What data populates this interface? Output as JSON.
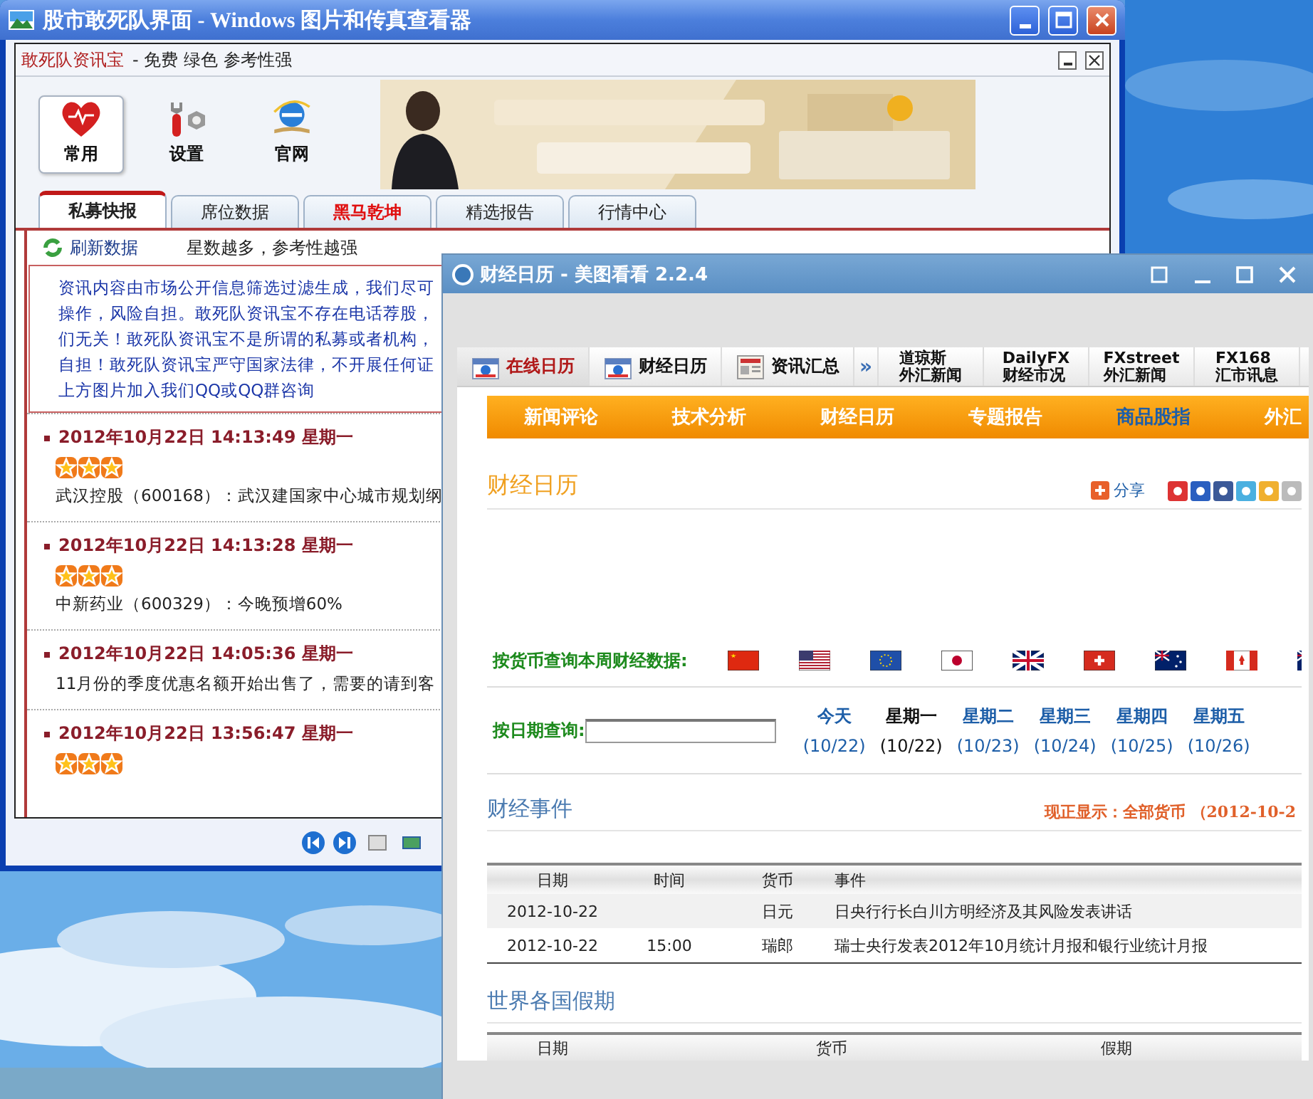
{
  "back_window": {
    "title": "股市敢死队界面 - Windows 图片和传真查看器",
    "app_name": "敢死队资讯宝",
    "app_tagline": "- 免费 绿色 参考性强",
    "tools": [
      {
        "label": "常用",
        "selected": true,
        "kind": "heart"
      },
      {
        "label": "设置",
        "selected": false,
        "kind": "wrench"
      },
      {
        "label": "官网",
        "selected": false,
        "kind": "browser"
      }
    ],
    "tabs": [
      {
        "label": "私募快报",
        "selected": true,
        "emphasized": false
      },
      {
        "label": "席位数据",
        "selected": false,
        "emphasized": false
      },
      {
        "label": "黑马乾坤",
        "selected": false,
        "emphasized": true
      },
      {
        "label": "精选报告",
        "selected": false,
        "emphasized": false
      },
      {
        "label": "行情中心",
        "selected": false,
        "emphasized": false
      }
    ],
    "refresh": "刷新数据",
    "hint": "星数越多，参考性越强",
    "notice": [
      "资讯内容由市场公开信息筛选过滤生成，我们尽可",
      "操作，风险自担。敢死队资讯宝不存在电话荐股，",
      "们无关！敢死队资讯宝不是所谓的私募或者机构，",
      "自担！敢死队资讯宝严守国家法律，不开展任何证",
      "上方图片加入我们QQ或QQ群咨询"
    ],
    "news": [
      {
        "date": "2012年10月22日",
        "time": "14:13:49",
        "weekday": "星期一",
        "stars": 3,
        "text": "武汉控股（600168）：武汉建国家中心城市规划纲"
      },
      {
        "date": "2012年10月22日",
        "time": "14:13:28",
        "weekday": "星期一",
        "stars": 3,
        "text": "中新药业（600329）：今晚预增60%"
      },
      {
        "date": "2012年10月22日",
        "time": "14:05:36",
        "weekday": "星期一",
        "text": "11月份的季度优惠名额开始出售了，需要的请到客"
      },
      {
        "date": "2012年10月22日",
        "time": "13:56:47",
        "weekday": "星期一",
        "stars": 3
      }
    ]
  },
  "front_window": {
    "title": "财经日历 - 美图看看 2.2.4",
    "nav_tabs": [
      {
        "kind": "icon",
        "label": "在线日历",
        "selected": true
      },
      {
        "kind": "icon",
        "label": "财经日历",
        "selected": false
      },
      {
        "kind": "news",
        "label": "资讯汇总",
        "selected": false
      },
      {
        "kind": "arrow",
        "label": "»",
        "selected": false
      },
      {
        "kind": "two-line",
        "label": "道琼斯",
        "sublabel": "外汇新闻",
        "selected": false
      },
      {
        "kind": "two-line",
        "label": "DailyFX",
        "sublabel": "财经市况",
        "selected": false
      },
      {
        "kind": "two-line",
        "label": "FXstreet",
        "sublabel": "外汇新闻",
        "selected": false
      },
      {
        "kind": "two-line",
        "label": "FX168",
        "sublabel": "汇市讯息",
        "selected": false
      }
    ],
    "menu": [
      {
        "label": "新闻评论",
        "selected": false
      },
      {
        "label": "技术分析",
        "selected": false
      },
      {
        "label": "财经日历",
        "selected": false
      },
      {
        "label": "专题报告",
        "selected": false
      },
      {
        "label": "商品股指",
        "selected": true
      },
      {
        "label": "外汇",
        "selected": false
      }
    ],
    "page_title": "财经日历",
    "share": "分享",
    "currency_label": "按货币查询本周财经数据:",
    "date_label": "按日期查询:",
    "days": [
      {
        "name": "今天",
        "date": "(10/22)",
        "selected": false
      },
      {
        "name": "星期一",
        "date": "(10/22)",
        "selected": true
      },
      {
        "name": "星期二",
        "date": "(10/23)",
        "selected": false
      },
      {
        "name": "星期三",
        "date": "(10/24)",
        "selected": false
      },
      {
        "name": "星期四",
        "date": "(10/25)",
        "selected": false
      },
      {
        "name": "星期五",
        "date": "(10/26)",
        "selected": false
      }
    ],
    "events_title": "财经事件",
    "showing": "现正显示：全部货币 （2012-10-2",
    "events_table": {
      "columns": [
        "日期",
        "时间",
        "货币",
        "事件"
      ],
      "rows": [
        [
          "2012-10-22",
          "",
          "日元",
          "日央行行长白川方明经济及其风险发表讲话"
        ],
        [
          "2012-10-22",
          "15:00",
          "瑞郎",
          "瑞士央行发表2012年10月统计月报和银行业统计月报"
        ]
      ]
    },
    "holidays_title": "世界各国假期",
    "holidays_table": {
      "columns": [
        "日期",
        "货币",
        "假期"
      ]
    }
  }
}
